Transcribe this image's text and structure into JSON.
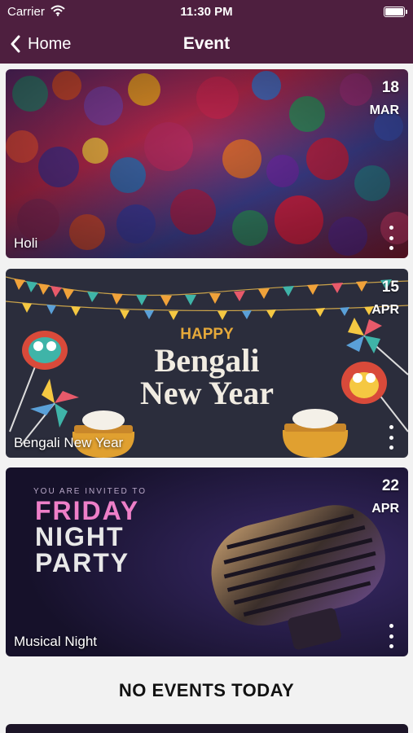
{
  "status_bar": {
    "carrier": "Carrier",
    "time": "11:30 PM"
  },
  "nav": {
    "back_label": "Home",
    "title": "Event"
  },
  "events": [
    {
      "name": "Holi",
      "day": "18",
      "month": "MAR"
    },
    {
      "name": "Bengali New Year",
      "day": "15",
      "month": "APR",
      "poster": {
        "line1": "HAPPY",
        "line2": "Bengali",
        "line3": "New Year"
      }
    },
    {
      "name": "Musical Night",
      "day": "22",
      "month": "APR",
      "poster": {
        "line1": "YOU ARE INVITED TO",
        "line2": "FRIDAY",
        "line3": "NIGHT",
        "line4": "PARTY"
      }
    }
  ],
  "empty_state": "NO EVENTS TODAY",
  "icons": [
    "wifi-icon",
    "battery-icon",
    "chevron-left-icon",
    "more-vertical-icon"
  ],
  "colors": {
    "header": "#4e1f3f",
    "background": "#f2f2f2",
    "text": "#111111"
  }
}
